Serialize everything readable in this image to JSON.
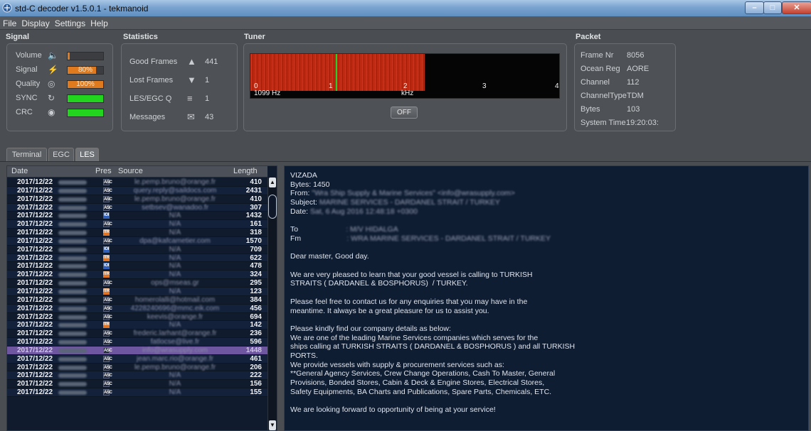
{
  "window": {
    "title": "std-C decoder v1.5.0.1 - tekmanoid"
  },
  "menu": [
    "File",
    "Display",
    "Settings",
    "Help"
  ],
  "signal": {
    "heading": "Signal",
    "rows": [
      {
        "label": "Volume",
        "icon": "speaker-icon",
        "level": 0.06,
        "text": "",
        "color": "#e07a1e"
      },
      {
        "label": "Signal",
        "icon": "lightning-icon",
        "level": 0.8,
        "text": "80%",
        "color": "#e07a1e"
      },
      {
        "label": "Quality",
        "icon": "target-icon",
        "level": 1.0,
        "text": "100%",
        "color": "#e07a1e"
      },
      {
        "label": "SYNC",
        "icon": "refresh-icon",
        "level": 1.0,
        "text": "",
        "color": "#22d41e"
      },
      {
        "label": "CRC",
        "icon": "fingerprint-icon",
        "level": 1.0,
        "text": "",
        "color": "#22d41e"
      }
    ]
  },
  "statistics": {
    "heading": "Statistics",
    "rows": [
      {
        "label": "Good Frames",
        "icon": "thumbs-up-icon",
        "value": "441"
      },
      {
        "label": "Lost Frames",
        "icon": "thumbs-down-icon",
        "value": "1"
      },
      {
        "label": "LES/EGC Q",
        "icon": "queue-icon",
        "value": "1"
      },
      {
        "label": "Messages",
        "icon": "envelope-icon",
        "value": "43"
      }
    ]
  },
  "tuner": {
    "heading": "Tuner",
    "ticks": [
      "0",
      "1",
      "2",
      "3",
      "4"
    ],
    "freq": "1099 Hz",
    "unit": "kHz",
    "button": "OFF"
  },
  "packet": {
    "heading": "Packet",
    "rows": [
      {
        "label": "Frame Nr",
        "value": "8056"
      },
      {
        "label": "Ocean Reg",
        "value": "AORE"
      },
      {
        "label": "Channel",
        "value": "112"
      },
      {
        "label": "ChannelType",
        "value": "TDM"
      },
      {
        "label": "Bytes",
        "value": "103"
      },
      {
        "label": "System Time",
        "value": "19:20:03:"
      }
    ]
  },
  "tabs": [
    "Terminal",
    "EGC",
    "LES"
  ],
  "list": {
    "headers": [
      "Date",
      "Pres",
      "Source",
      "Length"
    ],
    "rows": [
      {
        "date": "2017/12/22",
        "pres": "ASC",
        "src": "le.pemp.bruno@orange.fr",
        "len": "410"
      },
      {
        "date": "2017/12/22",
        "pres": "ASC",
        "src": "query.reply@saildocs.com",
        "len": "2431"
      },
      {
        "date": "2017/12/22",
        "pres": "ASC",
        "src": "le.pemp.bruno@orange.fr",
        "len": "410"
      },
      {
        "date": "2017/12/22",
        "pres": "ASC",
        "src": "setbsev@wanadoo.fr",
        "len": "307"
      },
      {
        "date": "2017/12/22",
        "pres": "IOI",
        "src": "N/A",
        "len": "1432"
      },
      {
        "date": "2017/12/22",
        "pres": "ASC",
        "src": "N/A",
        "len": "161"
      },
      {
        "date": "2017/12/22",
        "pres": "ITR",
        "src": "N/A",
        "len": "318"
      },
      {
        "date": "2017/12/22",
        "pres": "ASC",
        "src": "dpa@kafcametier.com",
        "len": "1570"
      },
      {
        "date": "2017/12/22",
        "pres": "IOI",
        "src": "N/A",
        "len": "709"
      },
      {
        "date": "2017/12/22",
        "pres": "ITR",
        "src": "N/A",
        "len": "622"
      },
      {
        "date": "2017/12/22",
        "pres": "IOI",
        "src": "N/A",
        "len": "478"
      },
      {
        "date": "2017/12/22",
        "pres": "ITR",
        "src": "N/A",
        "len": "324"
      },
      {
        "date": "2017/12/22",
        "pres": "ASC",
        "src": "ops@mseas.gr",
        "len": "295"
      },
      {
        "date": "2017/12/22",
        "pres": "ITR",
        "src": "N/A",
        "len": "123"
      },
      {
        "date": "2017/12/22",
        "pres": "ASC",
        "src": "homerolalli@hotmail.com",
        "len": "384"
      },
      {
        "date": "2017/12/22",
        "pres": "ASC",
        "src": "4228240696@mmc.eik.com",
        "len": "456"
      },
      {
        "date": "2017/12/22",
        "pres": "ASC",
        "src": "keevis@orange.fr",
        "len": "694"
      },
      {
        "date": "2017/12/22",
        "pres": "ITR",
        "src": "N/A",
        "len": "142"
      },
      {
        "date": "2017/12/22",
        "pres": "ASC",
        "src": "frederic.larhant@orange.fr",
        "len": "236"
      },
      {
        "date": "2017/12/22",
        "pres": "ASC",
        "src": "fatlocse@live.fr",
        "len": "596"
      },
      {
        "date": "2017/12/22",
        "pres": "ASC",
        "src": "info@wrasupply.com",
        "len": "1448",
        "selected": true
      },
      {
        "date": "2017/12/22",
        "pres": "ASC",
        "src": "jean.marc.rio@orange.fr",
        "len": "461"
      },
      {
        "date": "2017/12/22",
        "pres": "ASC",
        "src": "le.pemp.bruno@orange.fr",
        "len": "206"
      },
      {
        "date": "2017/12/22",
        "pres": "ASC",
        "src": "N/A",
        "len": "222"
      },
      {
        "date": "2017/12/22",
        "pres": "ASC",
        "src": "N/A",
        "len": "156"
      },
      {
        "date": "2017/12/22",
        "pres": "ASC",
        "src": "N/A",
        "len": "155"
      }
    ]
  },
  "message": {
    "lines": [
      {
        "t": "VIZADA",
        "blur": false
      },
      {
        "t": "Bytes: 1450",
        "blur": false
      },
      {
        "t": "From: \"Wra Ship Supply & Marine Services\" <info@wrasupply.com>",
        "blur": true,
        "prefix": "From: "
      },
      {
        "t": "Subject: MARINE SERVICES - DARDANEL STRAIT / TURKEY",
        "blur": true,
        "prefix": "Subject: "
      },
      {
        "t": "Date: Sat, 6 Aug 2016 12:48:18 +0300",
        "blur": true,
        "prefix": "Date: "
      },
      {
        "t": "",
        "blur": false
      },
      {
        "t": "To                       : M/V HIDALGA",
        "blur": true,
        "prefix": "To                       "
      },
      {
        "t": "Fm                      : WRA MARINE SERVICES - DARDANEL STRAIT / TURKEY",
        "blur": true,
        "prefix": "Fm                      "
      },
      {
        "t": "",
        "blur": false
      },
      {
        "t": "Dear master, Good day.",
        "blur": false
      },
      {
        "t": "",
        "blur": false
      },
      {
        "t": "We are very pleased to learn that your good vessel is calling to TURKISH",
        "blur": false
      },
      {
        "t": "STRAITS ( DARDANEL & BOSPHORUS)  / TURKEY.",
        "blur": false
      },
      {
        "t": "",
        "blur": false
      },
      {
        "t": "Please feel free to contact us for any enquiries that you may have in the",
        "blur": false
      },
      {
        "t": "meantime. It always be a great pleasure for us to assist you.",
        "blur": false
      },
      {
        "t": "",
        "blur": false
      },
      {
        "t": "Please kindly find our company details as below:",
        "blur": false
      },
      {
        "t": "We are one of the leading Marine Services companies which serves for the",
        "blur": false
      },
      {
        "t": "ships calling at TURKISH STRAITS ( DARDANEL & BOSPHORUS ) and all TURKISH",
        "blur": false
      },
      {
        "t": "PORTS.",
        "blur": false
      },
      {
        "t": "We provide vessels with supply & procurement services such as:",
        "blur": false
      },
      {
        "t": "**General Agency Services, Crew Change Operations, Cash To Master, General",
        "blur": false
      },
      {
        "t": "Provisions, Bonded Stores, Cabin & Deck & Engine Stores, Electrical Stores,",
        "blur": false
      },
      {
        "t": "Safety Equipments, BA Charts and Publications, Spare Parts, Chemicals, ETC.",
        "blur": false
      },
      {
        "t": "",
        "blur": false
      },
      {
        "t": "We are looking forward to opportunity of being at your service!",
        "blur": false
      }
    ]
  }
}
